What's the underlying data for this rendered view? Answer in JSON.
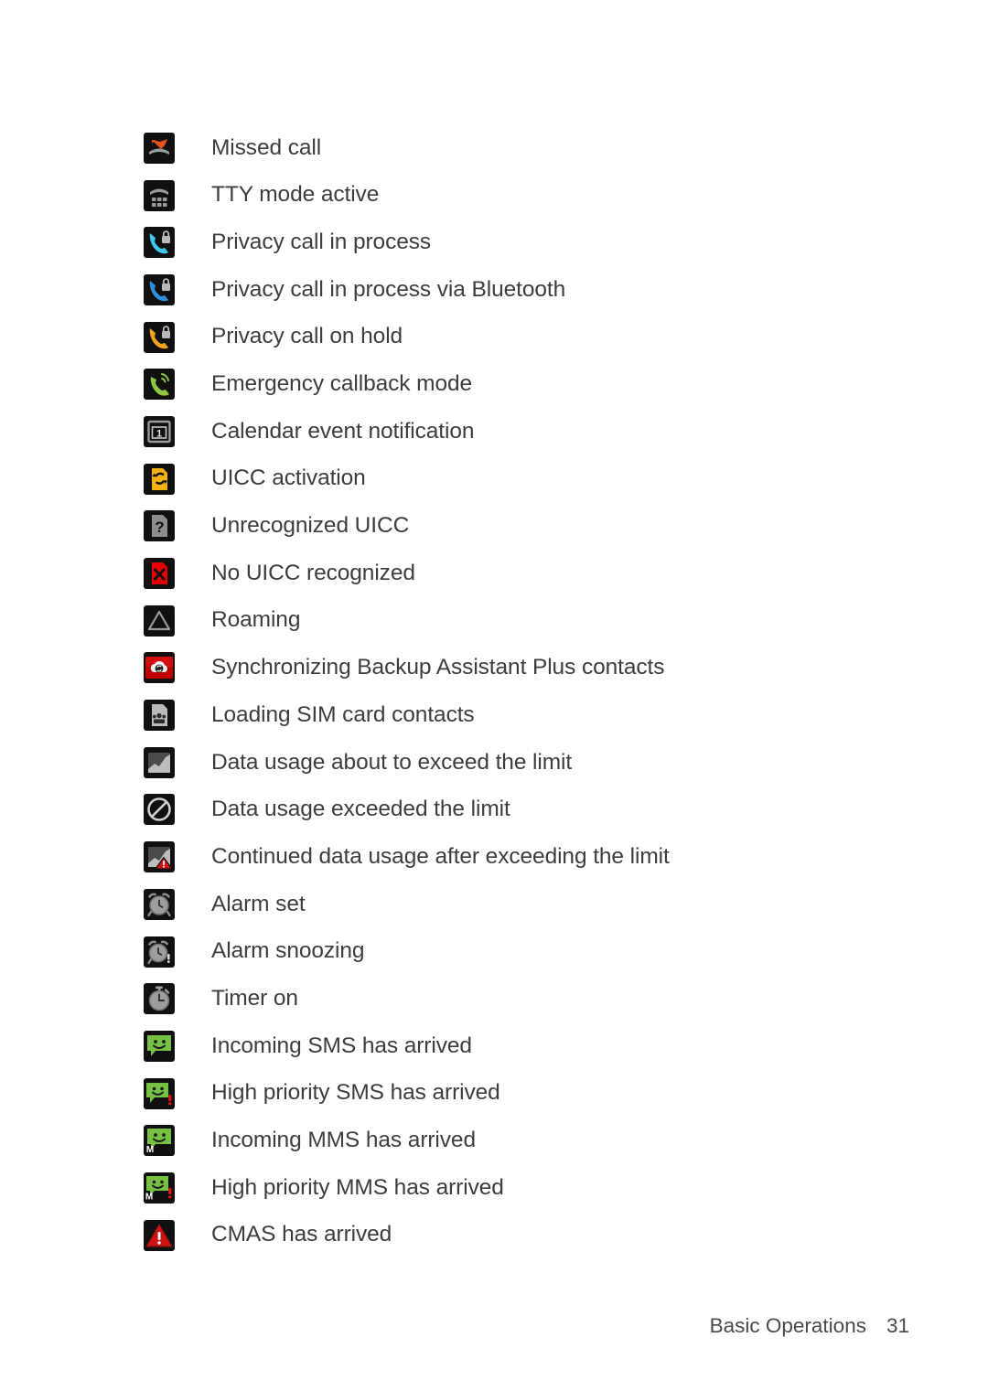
{
  "document": {
    "footer": {
      "section": "Basic Operations",
      "page_number": "31"
    }
  },
  "colors": {
    "text": "#3d3d3d",
    "icon_background": "#101010",
    "accent_orange": "#e8531c",
    "accent_cyan": "#3fc6ee",
    "accent_blue": "#2f8fdc",
    "accent_amber": "#f0a31b",
    "accent_green": "#8cc63e",
    "accent_red": "#e00000",
    "accent_gray": "#a8a8a8",
    "page_background": "#ffffff"
  },
  "icon_list": {
    "rows": [
      {
        "icon": "missed-call-icon",
        "label": "Missed call"
      },
      {
        "icon": "tty-mode-icon",
        "label": "TTY mode active"
      },
      {
        "icon": "privacy-call-in-process-icon",
        "label": "Privacy call in process"
      },
      {
        "icon": "privacy-call-bluetooth-icon",
        "label": "Privacy call in process via Bluetooth"
      },
      {
        "icon": "privacy-call-on-hold-icon",
        "label": "Privacy call on hold"
      },
      {
        "icon": "emergency-callback-icon",
        "label": "Emergency callback mode"
      },
      {
        "icon": "calendar-event-icon",
        "label": "Calendar event notification"
      },
      {
        "icon": "uicc-activation-icon",
        "label": "UICC activation"
      },
      {
        "icon": "unrecognized-uicc-icon",
        "label": "Unrecognized UICC"
      },
      {
        "icon": "no-uicc-icon",
        "label": "No UICC recognized"
      },
      {
        "icon": "roaming-icon",
        "label": "Roaming"
      },
      {
        "icon": "backup-assistant-sync-icon",
        "label": "Synchronizing Backup Assistant Plus contacts"
      },
      {
        "icon": "sim-contacts-loading-icon",
        "label": "Loading SIM card contacts"
      },
      {
        "icon": "data-usage-warning-icon",
        "label": "Data usage about to exceed the limit"
      },
      {
        "icon": "data-usage-exceeded-icon",
        "label": "Data usage exceeded the limit"
      },
      {
        "icon": "data-usage-continued-icon",
        "label": "Continued data usage after exceeding the limit"
      },
      {
        "icon": "alarm-set-icon",
        "label": "Alarm set"
      },
      {
        "icon": "alarm-snooze-icon",
        "label": "Alarm snoozing"
      },
      {
        "icon": "timer-on-icon",
        "label": "Timer on"
      },
      {
        "icon": "sms-received-icon",
        "label": "Incoming SMS has arrived"
      },
      {
        "icon": "sms-high-priority-icon",
        "label": "High priority SMS has arrived"
      },
      {
        "icon": "mms-received-icon",
        "label": "Incoming MMS has arrived"
      },
      {
        "icon": "mms-high-priority-icon",
        "label": "High priority MMS has arrived"
      },
      {
        "icon": "cmas-alert-icon",
        "label": "CMAS has arrived"
      }
    ]
  }
}
